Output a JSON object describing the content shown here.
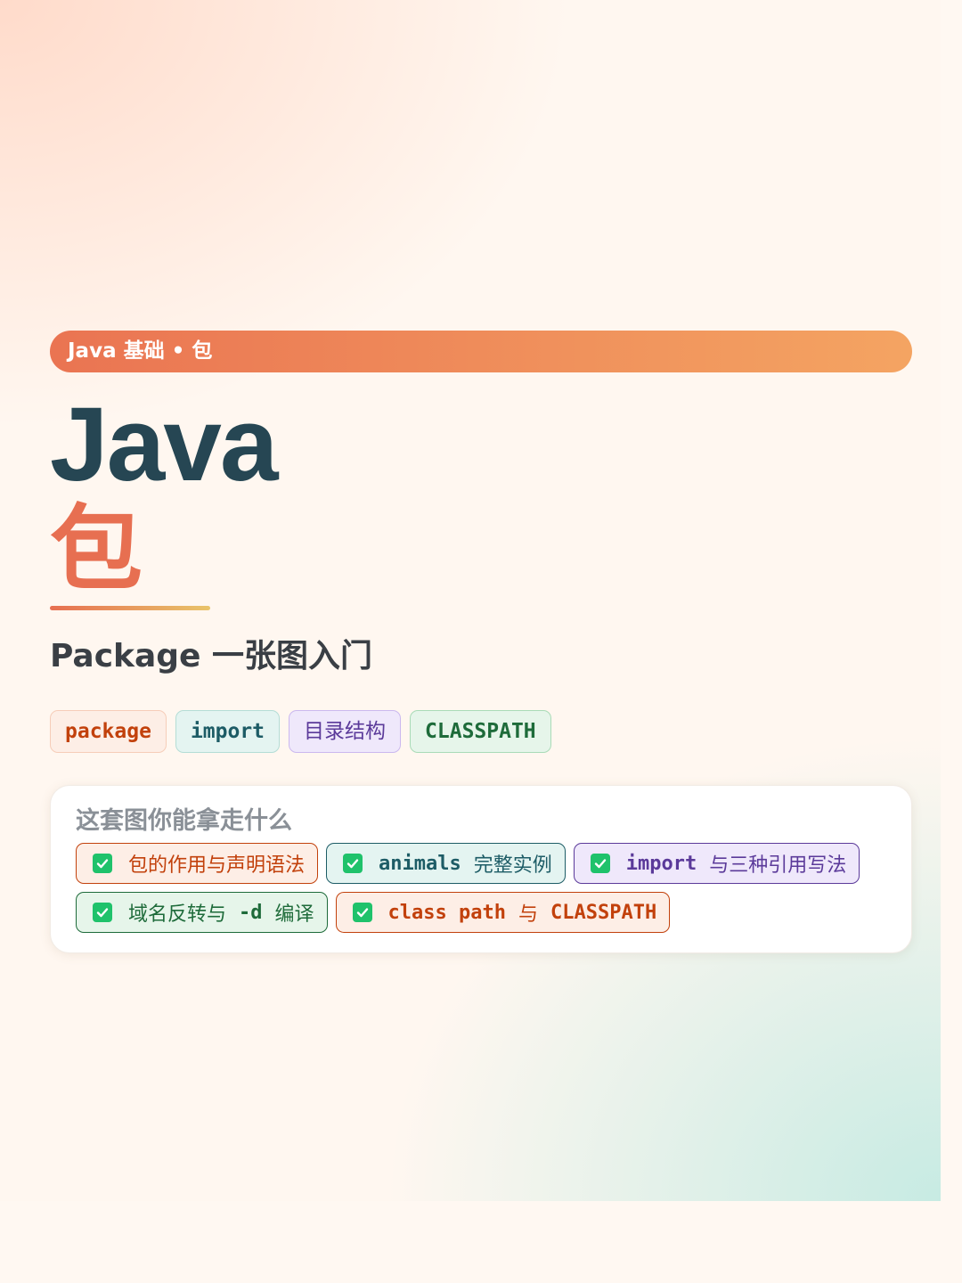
{
  "banner": {
    "text": "Java 基础 • 包"
  },
  "title": {
    "en": "Java",
    "zh": "包"
  },
  "subtitle": "Package 一张图入门",
  "tags": [
    {
      "label": "package",
      "color": "#c2410c"
    },
    {
      "label": "import",
      "color": "#1d5c66"
    },
    {
      "label": "目录结构",
      "color": "#5b3a9a"
    },
    {
      "label": "CLASSPATH",
      "color": "#1e6b3a"
    }
  ],
  "card": {
    "title": "这套图你能拿走什么",
    "check_icon": "check-square-icon",
    "check_color": "#1fc26b",
    "items": [
      {
        "text": "包的作用与声明语法"
      },
      {
        "code": "animals",
        "text": "完整实例"
      },
      {
        "code": "import",
        "text": "与三种引用写法"
      },
      {
        "text": "域名反转与",
        "code": "-d",
        "text2": "编译"
      },
      {
        "code": "class path",
        "text": "与",
        "code2": "CLASSPATH"
      }
    ]
  },
  "colors": {
    "title_dark": "#264653",
    "accent": "#e76f51",
    "banner_start": "#ea7452",
    "banner_end": "#f4a462"
  }
}
